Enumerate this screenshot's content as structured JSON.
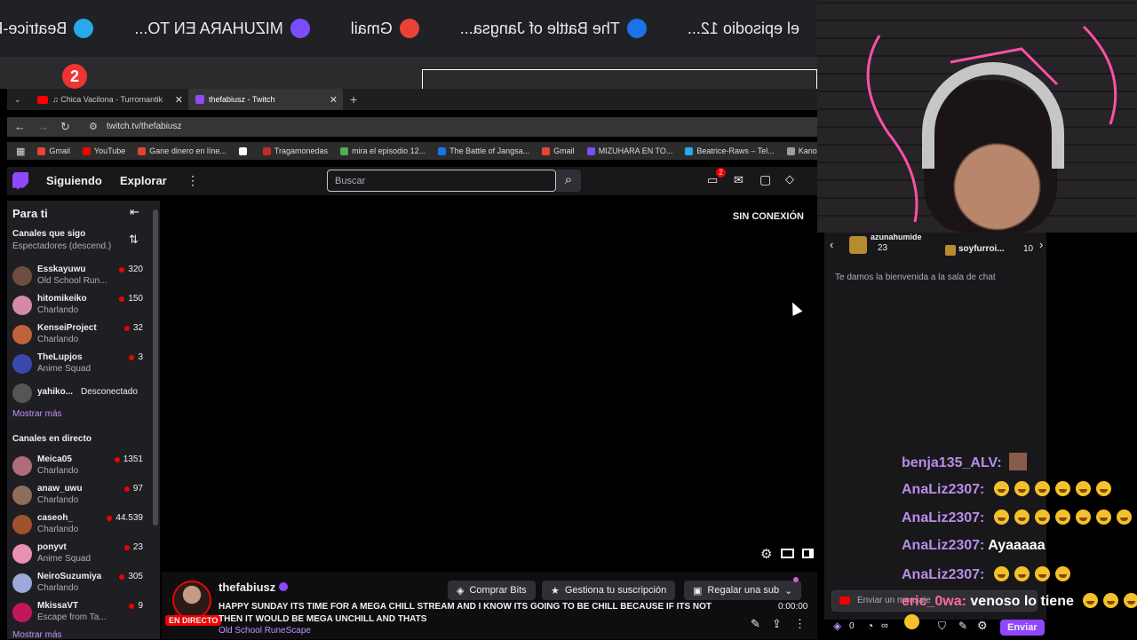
{
  "mirror_bar": {
    "items": [
      "el episodio 12...",
      "The Battle of Jangsa...",
      "Gmail",
      "MIZUHARA EN TO...",
      "Beatrice-Raws - T"
    ],
    "badge": "2"
  },
  "browser": {
    "tabs": [
      {
        "label": "♫ Chica Vacilona - Turromantik"
      },
      {
        "label": "thefabiusz - Twitch"
      }
    ],
    "new_tab": "+",
    "url": "twitch.tv/thefabiusz",
    "bookmarks": [
      {
        "label": "Gmail",
        "color": "#ea4335"
      },
      {
        "label": "YouTube",
        "color": "#ff0000"
      },
      {
        "label": "Gane dinero en líne...",
        "color": "#e2452d"
      },
      {
        "label": "",
        "color": "#ffffff"
      },
      {
        "label": "Tragamonedas",
        "color": "#c62828"
      },
      {
        "label": "mira el episodio 12...",
        "color": "#4caf50"
      },
      {
        "label": "The Battle of Jangsa...",
        "color": "#1a73e8"
      },
      {
        "label": "Gmail",
        "color": "#ea4335"
      },
      {
        "label": "MIZUHARA EN TO...",
        "color": "#7c4dff"
      },
      {
        "label": "Beatrice-Raws – Tel...",
        "color": "#29a9eb"
      },
      {
        "label": "Kano",
        "color": "#9e9e9e"
      }
    ]
  },
  "nav": {
    "following": "Siguiendo",
    "browse": "Explorar",
    "more": "⋮",
    "search_placeholder": "Buscar",
    "notif_badge": "2"
  },
  "sidebar": {
    "for_you": "Para ti",
    "followed_title": "Canales que sigo",
    "followed_sub": "Espectadores (descend.)",
    "followed": [
      {
        "name": "Esskayuwu",
        "game": "Old School Run...",
        "viewers": "320",
        "color": "#6d4c41"
      },
      {
        "name": "hitomikeiko",
        "game": "Charlando",
        "viewers": "150",
        "color": "#d48aa6"
      },
      {
        "name": "KenseiProject",
        "game": "Charlando",
        "viewers": "32",
        "color": "#c0633a"
      },
      {
        "name": "TheLupjos",
        "game": "Anime Squad",
        "viewers": "3",
        "color": "#3949ab"
      },
      {
        "name": "yahiko...",
        "status": "Desconectado",
        "color": "#555"
      }
    ],
    "show_more": "Mostrar más",
    "live_title": "Canales en directo",
    "live": [
      {
        "name": "Meica05",
        "game": "Charlando",
        "viewers": "1351",
        "color": "#b06c7c"
      },
      {
        "name": "anaw_uwu",
        "game": "Charlando",
        "viewers": "97",
        "color": "#8e6d5a"
      },
      {
        "name": "caseoh_",
        "game": "Charlando",
        "viewers": "44.539",
        "color": "#a0522d"
      },
      {
        "name": "ponyvt",
        "game": "Anime Squad",
        "viewers": "23",
        "color": "#e88fb4"
      },
      {
        "name": "NeiroSuzumiya",
        "game": "Charlando",
        "viewers": "305",
        "color": "#9fa8da"
      },
      {
        "name": "MkissaVT",
        "game": "Escape from Ta...",
        "viewers": "9",
        "color": "#c2185b"
      }
    ],
    "show_more_2": "Mostrar más"
  },
  "player": {
    "offline": "SIN CONEXIÓN"
  },
  "stream_info": {
    "channel": "thefabiusz",
    "live_badge": "EN DIRECTO",
    "title": "HAPPY SUNDAY ITS TIME FOR A MEGA CHILL STREAM AND I KNOW ITS GOING TO BE CHILL BECAUSE IF ITS NOT THEN IT WOULD BE MEGA UNCHILL AND THATS",
    "game": "Old School RuneScape",
    "bits": "Comprar Bits",
    "manage_sub": "Gestiona tu suscripción",
    "gift_sub": "Regalar una sub",
    "uptime": "0:00:00"
  },
  "chat": {
    "gifters": [
      {
        "name": "azunahumide",
        "count": "23"
      },
      {
        "name": "soyfurroi...",
        "count": "10"
      }
    ],
    "welcome": "Te damos la bienvenida a la sala de chat",
    "messages": [
      {
        "user": "benja135_ALV:",
        "text": "",
        "emotes": 0,
        "image": true
      },
      {
        "user": "AnaLiz2307:",
        "text": "",
        "emotes": 6
      },
      {
        "user": "AnaLiz2307:",
        "text": "",
        "emotes": 7
      },
      {
        "user": "AnaLiz2307:",
        "text": "Ayaaaaa",
        "emotes": 0
      },
      {
        "user": "AnaLiz2307:",
        "text": "",
        "emotes": 4
      },
      {
        "user": "eric_0wa:",
        "text": "venoso lo tiene",
        "emotes": 3
      }
    ],
    "input_placeholder": "Enviar un mensaje",
    "points": "0",
    "infinity": "∞",
    "send": "Enviar"
  }
}
